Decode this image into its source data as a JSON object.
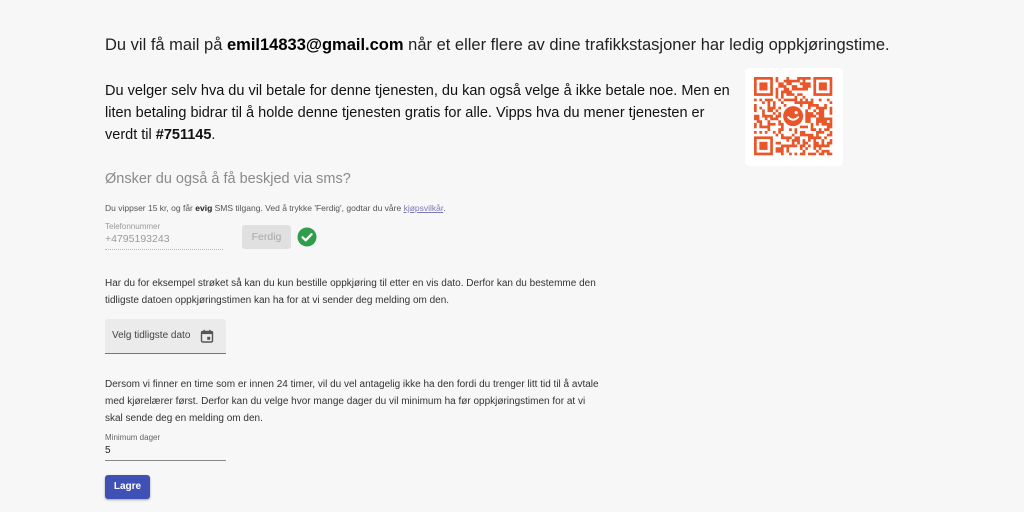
{
  "notification": {
    "prefix": "Du vil få mail på ",
    "email": "emil14833@gmail.com",
    "suffix": " når et eller flere av dine trafikkstasjoner har ledig oppkjøringstime."
  },
  "payment": {
    "text": "Du velger selv hva du vil betale for denne tjenesten, du kan også velge å ikke betale noe. Men en liten betaling bidrar til å holde denne tjenesten gratis for alle. Vipps hva du mener tjenesten er verdt til ",
    "number": "#751145",
    "end": "."
  },
  "qr": {
    "color": "#e8562a",
    "icon": "vipps-qr-code"
  },
  "sms": {
    "question": "Ønsker du også å få beskjed via sms?",
    "note_a": "Du vippser 15 kr, og får ",
    "note_bold": "evig",
    "note_b": " SMS tilgang. Ved å trykke 'Ferdig', godtar du våre ",
    "terms_link": "kjøpsvilkår",
    "note_end": ".",
    "phone_label": "Telefonnummer",
    "phone_value": "+4795193243",
    "done_button": "Ferdig",
    "status_icon": "check-circle-icon",
    "status_color": "#2e9e4a"
  },
  "earliest": {
    "description": "Har du for eksempel strøket så kan du kun bestille oppkjøring til etter en vis dato. Derfor kan du bestemme den tidligste datoen oppkjøringstimen kan ha for at vi sender deg melding om den.",
    "date_placeholder": "Velg tidligste dato"
  },
  "minimum": {
    "description": "Dersom vi finner en time som er innen 24 timer, vil du vel antagelig ikke ha den fordi du trenger litt tid til å avtale med kjørelærer først. Derfor kan du velge hvor mange dager du vil minimum ha før oppkjøringstimen for at vi skal sende deg en melding om den.",
    "label": "Minimum dager",
    "value": "5"
  },
  "save_button": "Lagre",
  "accent": "#3f51b5"
}
